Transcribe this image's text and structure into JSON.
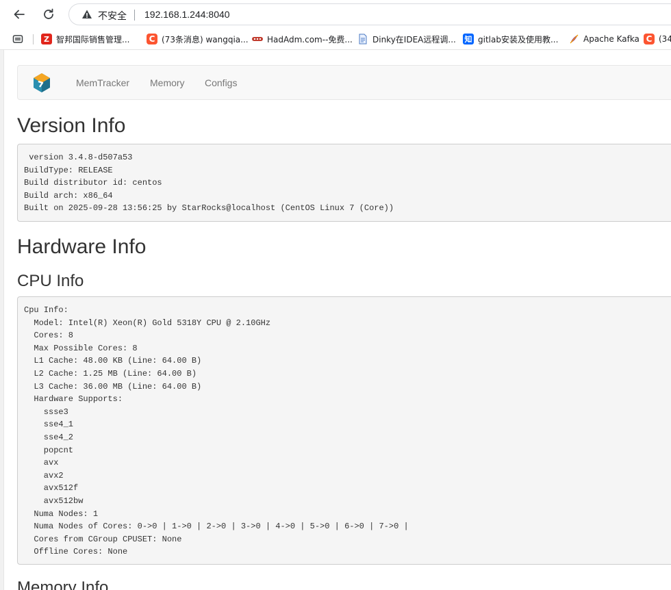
{
  "browser": {
    "security_label": "不安全",
    "url": "192.168.1.244:8040"
  },
  "bookmarks": [
    {
      "label": "智邦国际销售管理...",
      "icon": "zbintel-icon"
    },
    {
      "label": "(73条消息) wangqia...",
      "icon": "csdn-icon"
    },
    {
      "label": "HadAdm.com--免费...",
      "icon": "hadadm-icon"
    },
    {
      "label": "Dinky在IDEA远程调...",
      "icon": "document-icon"
    },
    {
      "label": "gitlab安装及使用教...",
      "icon": "zhihu-icon"
    },
    {
      "label": "Apache Kafka",
      "icon": "kafka-icon"
    },
    {
      "label": "(34",
      "icon": "csdn-icon"
    }
  ],
  "navbar": {
    "links": [
      "MemTracker",
      "Memory",
      "Configs"
    ]
  },
  "version": {
    "title": "Version Info",
    "text": " version 3.4.8-d507a53\nBuildType: RELEASE\nBuild distributor id: centos\nBuild arch: x86_64\nBuilt on 2025-09-28 13:56:25 by StarRocks@localhost (CentOS Linux 7 (Core))"
  },
  "hardware": {
    "title": "Hardware Info",
    "cpu_title": "CPU Info",
    "cpu_text": "Cpu Info:\n  Model: Intel(R) Xeon(R) Gold 5318Y CPU @ 2.10GHz\n  Cores: 8\n  Max Possible Cores: 8\n  L1 Cache: 48.00 KB (Line: 64.00 B)\n  L2 Cache: 1.25 MB (Line: 64.00 B)\n  L3 Cache: 36.00 MB (Line: 64.00 B)\n  Hardware Supports:\n    ssse3\n    sse4_1\n    sse4_2\n    popcnt\n    avx\n    avx2\n    avx512f\n    avx512bw\n  Numa Nodes: 1\n  Numa Nodes of Cores: 0->0 | 1->0 | 2->0 | 3->0 | 4->0 | 5->0 | 6->0 | 7->0 |\n  Cores from CGroup CPUSET: None\n  Offline Cores: None",
    "memory_title": "Memory Info"
  },
  "colors": {
    "navbar_bg": "#f8f8f8",
    "pre_bg": "#f5f5f5",
    "nav_link": "#777777",
    "heading": "#333333"
  }
}
